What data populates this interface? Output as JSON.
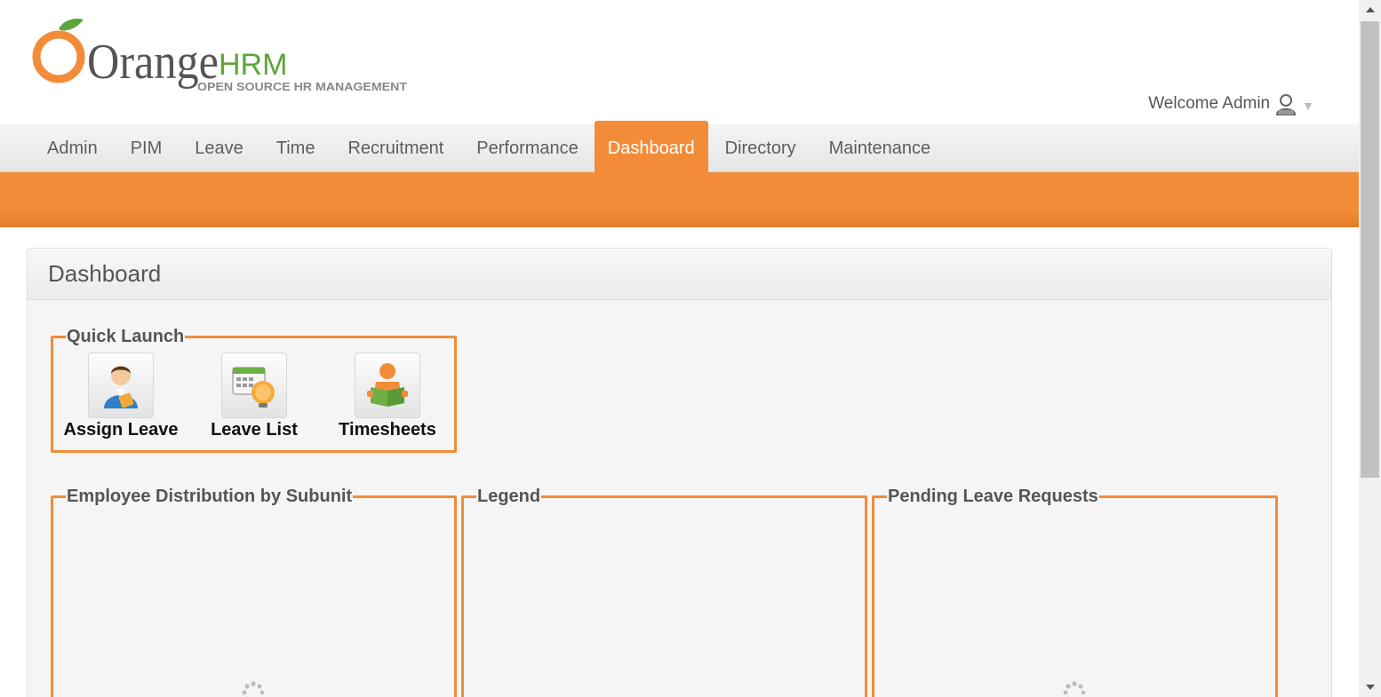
{
  "brand": {
    "logo_text": "Orange",
    "logo_hrm": "HRM",
    "logo_tagline": "OPEN SOURCE HR MANAGEMENT"
  },
  "user": {
    "welcome": "Welcome Admin"
  },
  "menu": {
    "items": [
      {
        "label": "Admin"
      },
      {
        "label": "PIM"
      },
      {
        "label": "Leave"
      },
      {
        "label": "Time"
      },
      {
        "label": "Recruitment"
      },
      {
        "label": "Performance"
      },
      {
        "label": "Dashboard",
        "active": true
      },
      {
        "label": "Directory"
      },
      {
        "label": "Maintenance"
      }
    ]
  },
  "dashboard": {
    "title": "Dashboard",
    "quick_launch": {
      "title": "Quick Launch",
      "items": [
        {
          "label": "Assign Leave",
          "icon": "assign-leave-icon"
        },
        {
          "label": "Leave List",
          "icon": "leave-list-icon"
        },
        {
          "label": "Timesheets",
          "icon": "timesheets-icon"
        }
      ]
    },
    "widgets": {
      "employee_distribution": "Employee Distribution by Subunit",
      "legend": "Legend",
      "pending_leave": "Pending Leave Requests"
    }
  },
  "colors": {
    "accent": "#f28c38",
    "menu_text": "#5d5d5d",
    "panel_bg": "#f5f5f5"
  }
}
